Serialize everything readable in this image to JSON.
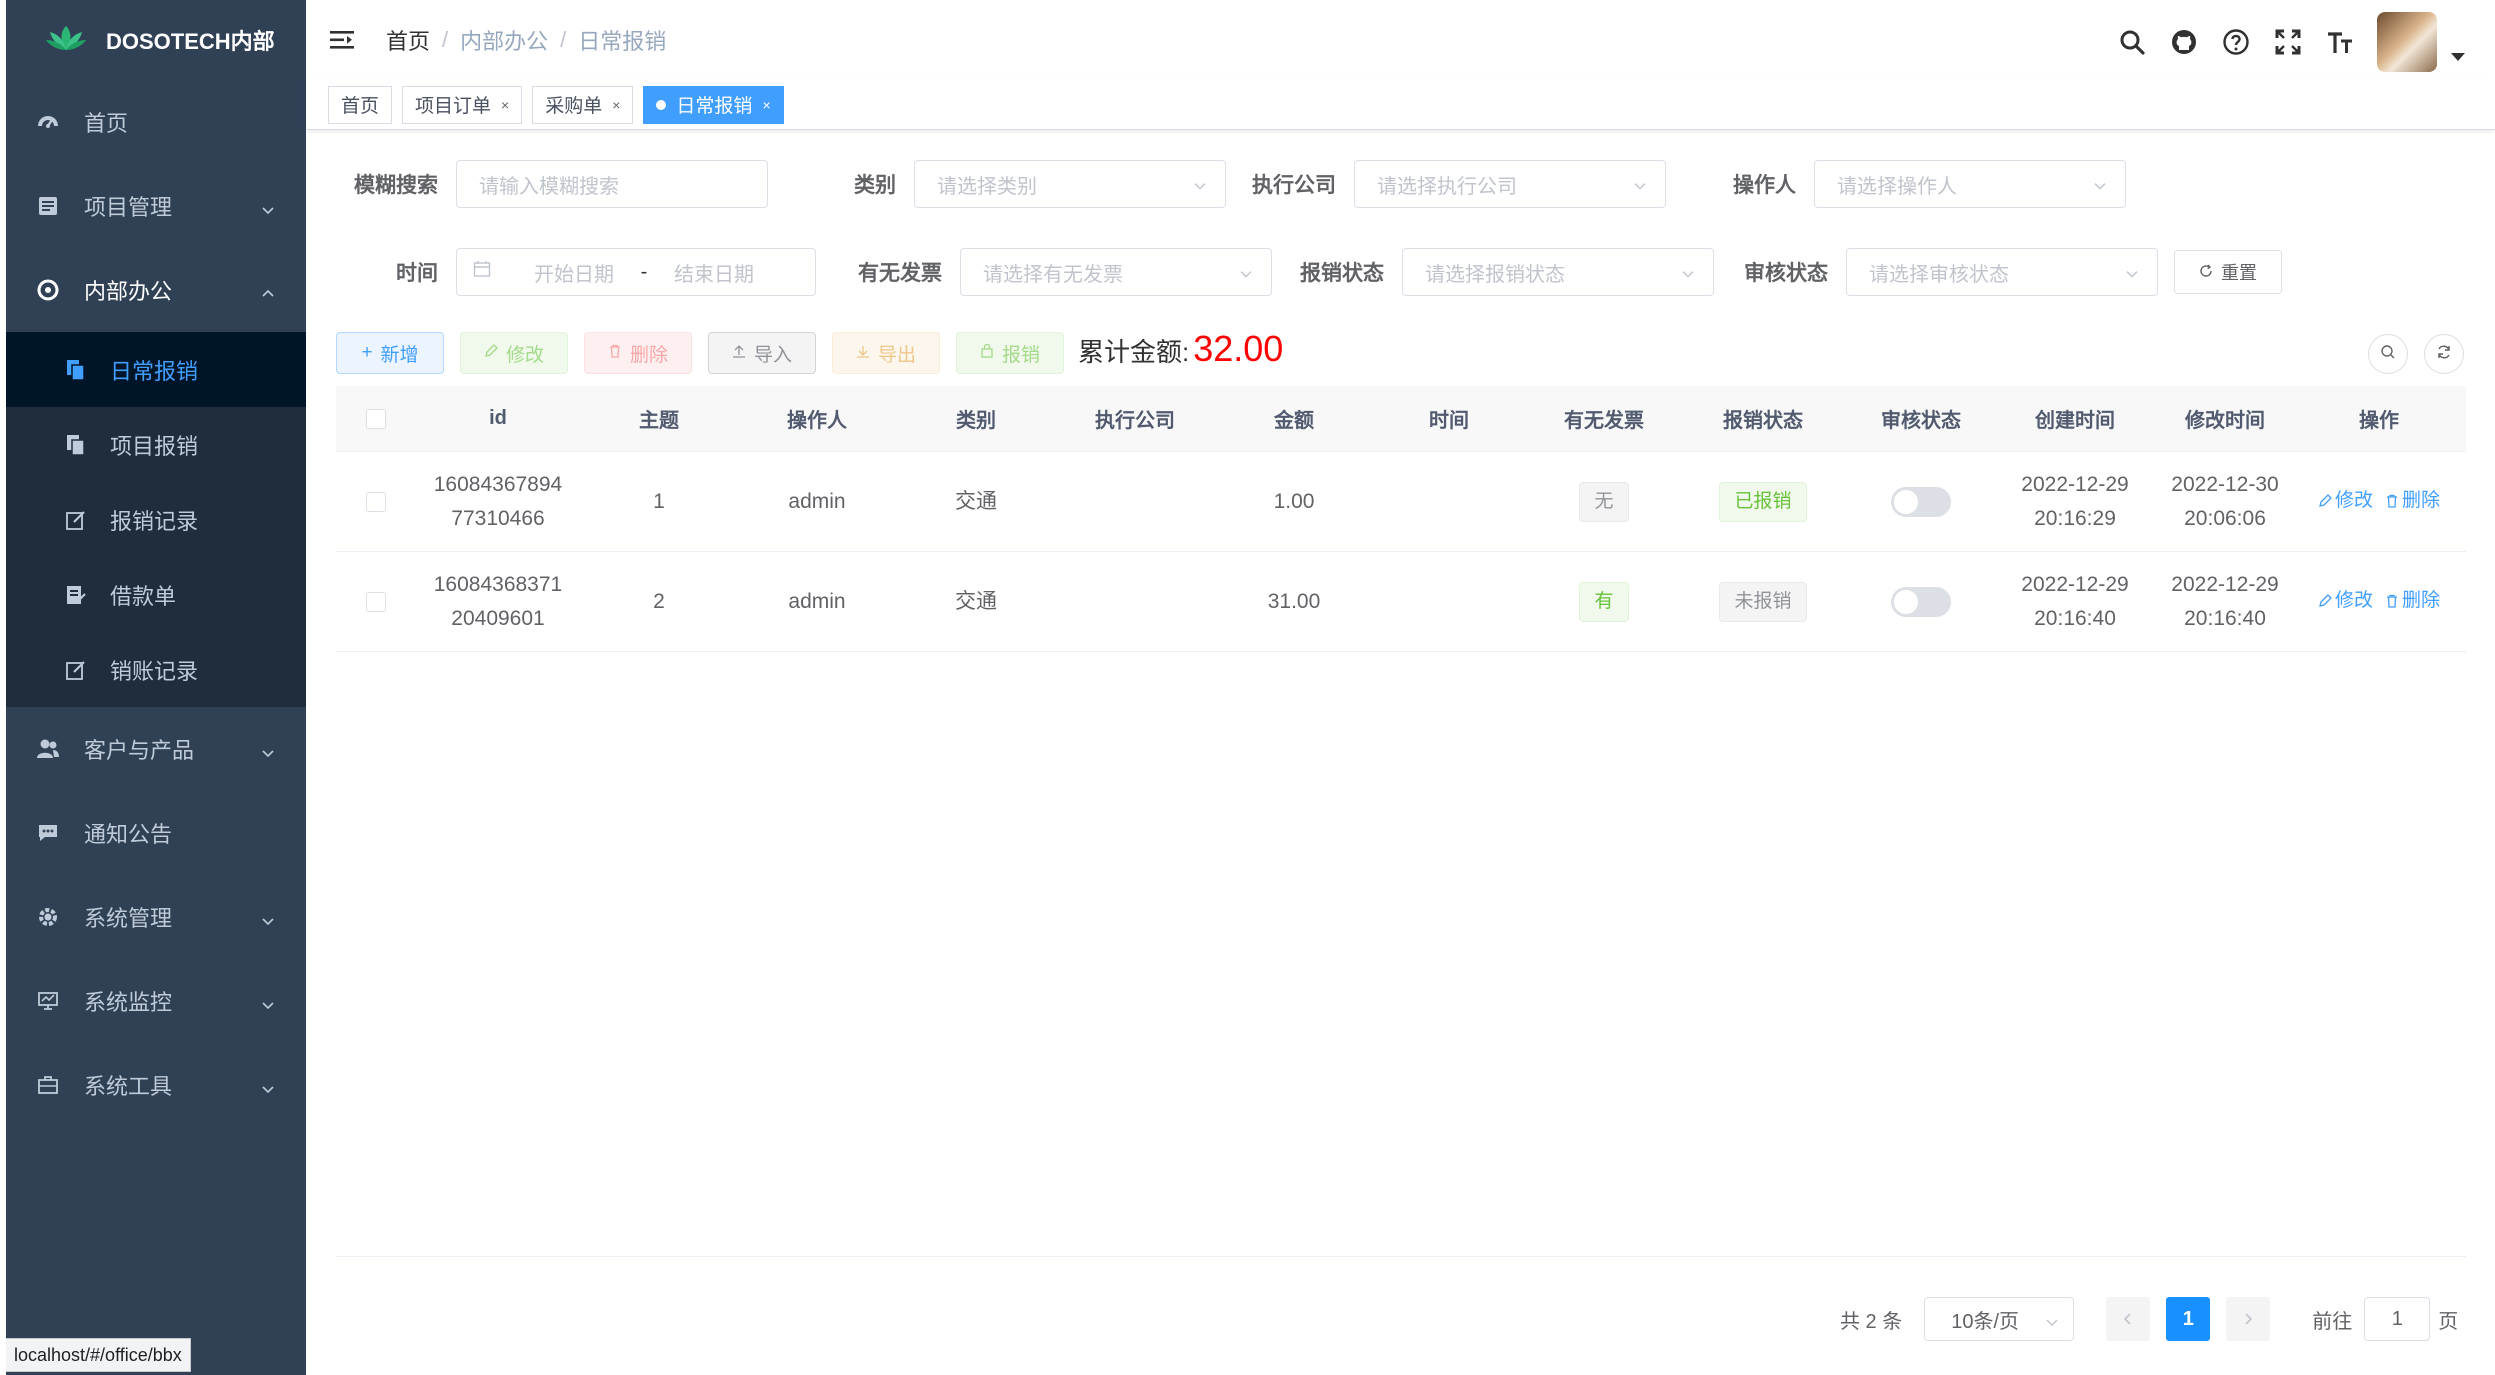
{
  "brand": {
    "title": "DOSOTECH内部"
  },
  "sidebar": {
    "items": [
      {
        "label": "首页",
        "icon": "dashboard-icon"
      },
      {
        "label": "项目管理",
        "icon": "document-icon",
        "expandable": true
      },
      {
        "label": "内部办公",
        "icon": "office-icon",
        "expandable": true,
        "expanded": true
      }
    ],
    "sub_items": [
      {
        "label": "日常报销",
        "active": true
      },
      {
        "label": "项目报销"
      },
      {
        "label": "报销记录"
      },
      {
        "label": "借款单"
      },
      {
        "label": "销账记录"
      }
    ],
    "items_after": [
      {
        "label": "客户与产品",
        "icon": "peoples-icon",
        "expandable": true
      },
      {
        "label": "通知公告",
        "icon": "message-icon"
      },
      {
        "label": "系统管理",
        "icon": "gear-icon",
        "expandable": true
      },
      {
        "label": "系统监控",
        "icon": "monitor-icon",
        "expandable": true
      },
      {
        "label": "系统工具",
        "icon": "toolbox-icon",
        "expandable": true
      }
    ]
  },
  "breadcrumb": [
    "首页",
    "内部办公",
    "日常报销"
  ],
  "tags": [
    {
      "label": "首页",
      "closable": false
    },
    {
      "label": "项目订单",
      "closable": true
    },
    {
      "label": "采购单",
      "closable": true
    },
    {
      "label": "日常报销",
      "closable": true,
      "active": true
    }
  ],
  "search": {
    "fuzzy_label": "模糊搜索",
    "fuzzy_placeholder": "请输入模糊搜索",
    "category_label": "类别",
    "category_placeholder": "请选择类别",
    "company_label": "执行公司",
    "company_placeholder": "请选择执行公司",
    "operator_label": "操作人",
    "operator_placeholder": "请选择操作人",
    "time_label": "时间",
    "start_placeholder": "开始日期",
    "range_sep": "-",
    "end_placeholder": "结束日期",
    "invoice_label": "有无发票",
    "invoice_placeholder": "请选择有无发票",
    "reimb_label": "报销状态",
    "reimb_placeholder": "请选择报销状态",
    "audit_label": "审核状态",
    "audit_placeholder": "请选择审核状态",
    "reset_label": "重置"
  },
  "toolbar": {
    "add": "新增",
    "edit": "修改",
    "delete": "删除",
    "import": "导入",
    "export": "导出",
    "reimburse": "报销",
    "total_label": "累计金额:",
    "total_value": "32.00"
  },
  "table": {
    "headers": [
      "id",
      "主题",
      "操作人",
      "类别",
      "执行公司",
      "金额",
      "时间",
      "有无发票",
      "报销状态",
      "审核状态",
      "创建时间",
      "修改时间",
      "操作"
    ],
    "rows": [
      {
        "id_1": "16084367894",
        "id_2": "77310466",
        "subject": "1",
        "operator": "admin",
        "category": "交通",
        "company": "",
        "amount": "1.00",
        "time": "",
        "invoice": "无",
        "invoice_type": "info",
        "reimb": "已报销",
        "reimb_type": "success",
        "audit_on": false,
        "created_date": "2022-12-29",
        "created_time": "20:16:29",
        "modified_date": "2022-12-30",
        "modified_time": "20:06:06",
        "edit": "修改",
        "delete": "删除"
      },
      {
        "id_1": "16084368371",
        "id_2": "20409601",
        "subject": "2",
        "operator": "admin",
        "category": "交通",
        "company": "",
        "amount": "31.00",
        "time": "",
        "invoice": "有",
        "invoice_type": "success",
        "reimb": "未报销",
        "reimb_type": "info",
        "audit_on": false,
        "created_date": "2022-12-29",
        "created_time": "20:16:40",
        "modified_date": "2022-12-29",
        "modified_time": "20:16:40",
        "edit": "修改",
        "delete": "删除"
      }
    ]
  },
  "pagination": {
    "total": "共 2 条",
    "page_size": "10条/页",
    "current": "1",
    "goto_label": "前往",
    "goto_value": "1",
    "page_suffix": "页"
  },
  "statusbar": {
    "url": "localhost/#/office/bbx"
  },
  "colors": {
    "sidebar_bg": "#304156",
    "submenu_bg": "#1f2d3d",
    "active_sub_bg": "#001528",
    "primary": "#409eff",
    "total_value": "#ff0000"
  }
}
